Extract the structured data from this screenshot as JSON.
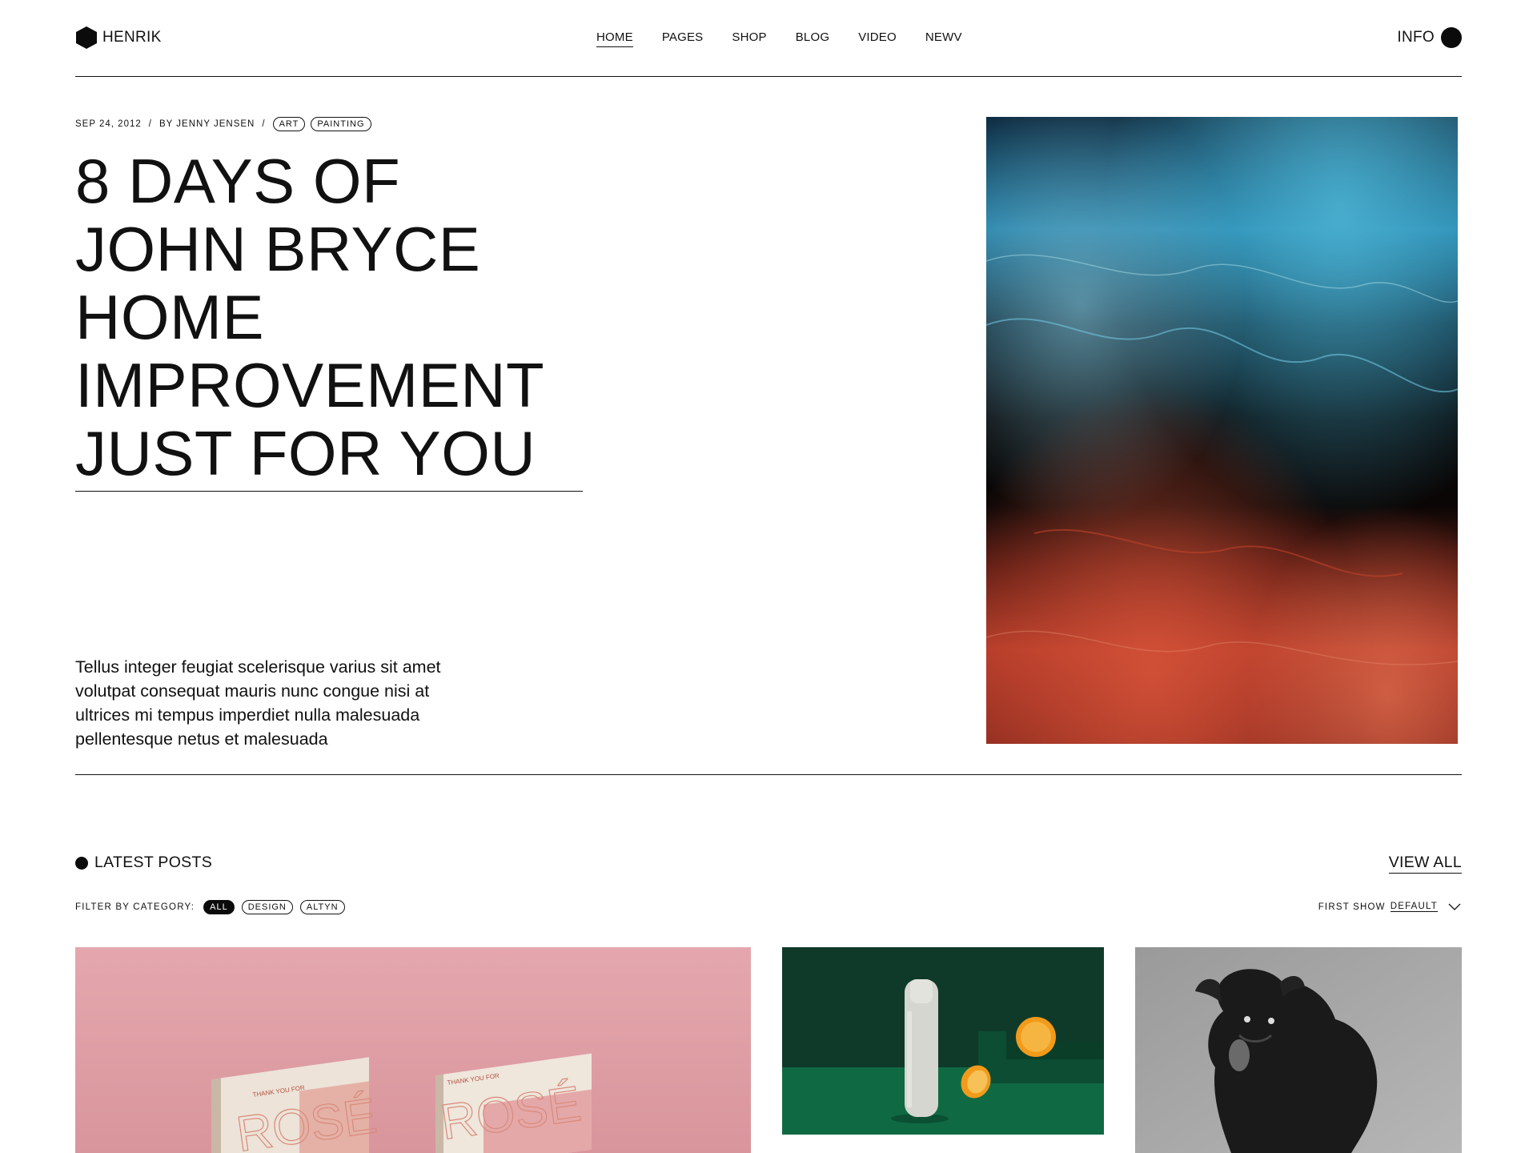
{
  "brand": {
    "name": "HENRIK"
  },
  "nav": {
    "items": [
      {
        "label": "HOME",
        "active": true
      },
      {
        "label": "PAGES"
      },
      {
        "label": "SHOP"
      },
      {
        "label": "BLOG"
      },
      {
        "label": "VIDEO"
      },
      {
        "label": "NEWV"
      }
    ],
    "info_label": "INFO"
  },
  "hero": {
    "date": "SEP 24, 2012",
    "author": "BY JENNY JENSEN",
    "separator": "/",
    "tags": [
      "ART",
      "PAINTING"
    ],
    "title": "8 DAYS OF JOHN BRYCE HOME IMPROVEMENT JUST FOR YOU",
    "excerpt": "Tellus integer feugiat scelerisque varius sit amet volutpat consequat mauris nunc congue nisi at ultrices mi tempus imperdiet nulla malesuada pellentesque netus et malesuada"
  },
  "latest": {
    "title": "LATEST POSTS",
    "view_all": "VIEW ALL",
    "filter_label": "FILTER BY CATEGORY:",
    "filters": [
      {
        "label": "ALL",
        "active": true
      },
      {
        "label": "DESIGN"
      },
      {
        "label": "ALTYN"
      }
    ],
    "sort_label": "FIRST SHOW",
    "sort_value": "DEFAULT",
    "book_cover_text": "ROSÉ",
    "book_cover_small": "THANK YOU FOR"
  },
  "colors": {
    "text": "#111111",
    "background": "#ffffff",
    "pink_card": "#e0a0a6",
    "green_card": "#0f3a2a"
  }
}
